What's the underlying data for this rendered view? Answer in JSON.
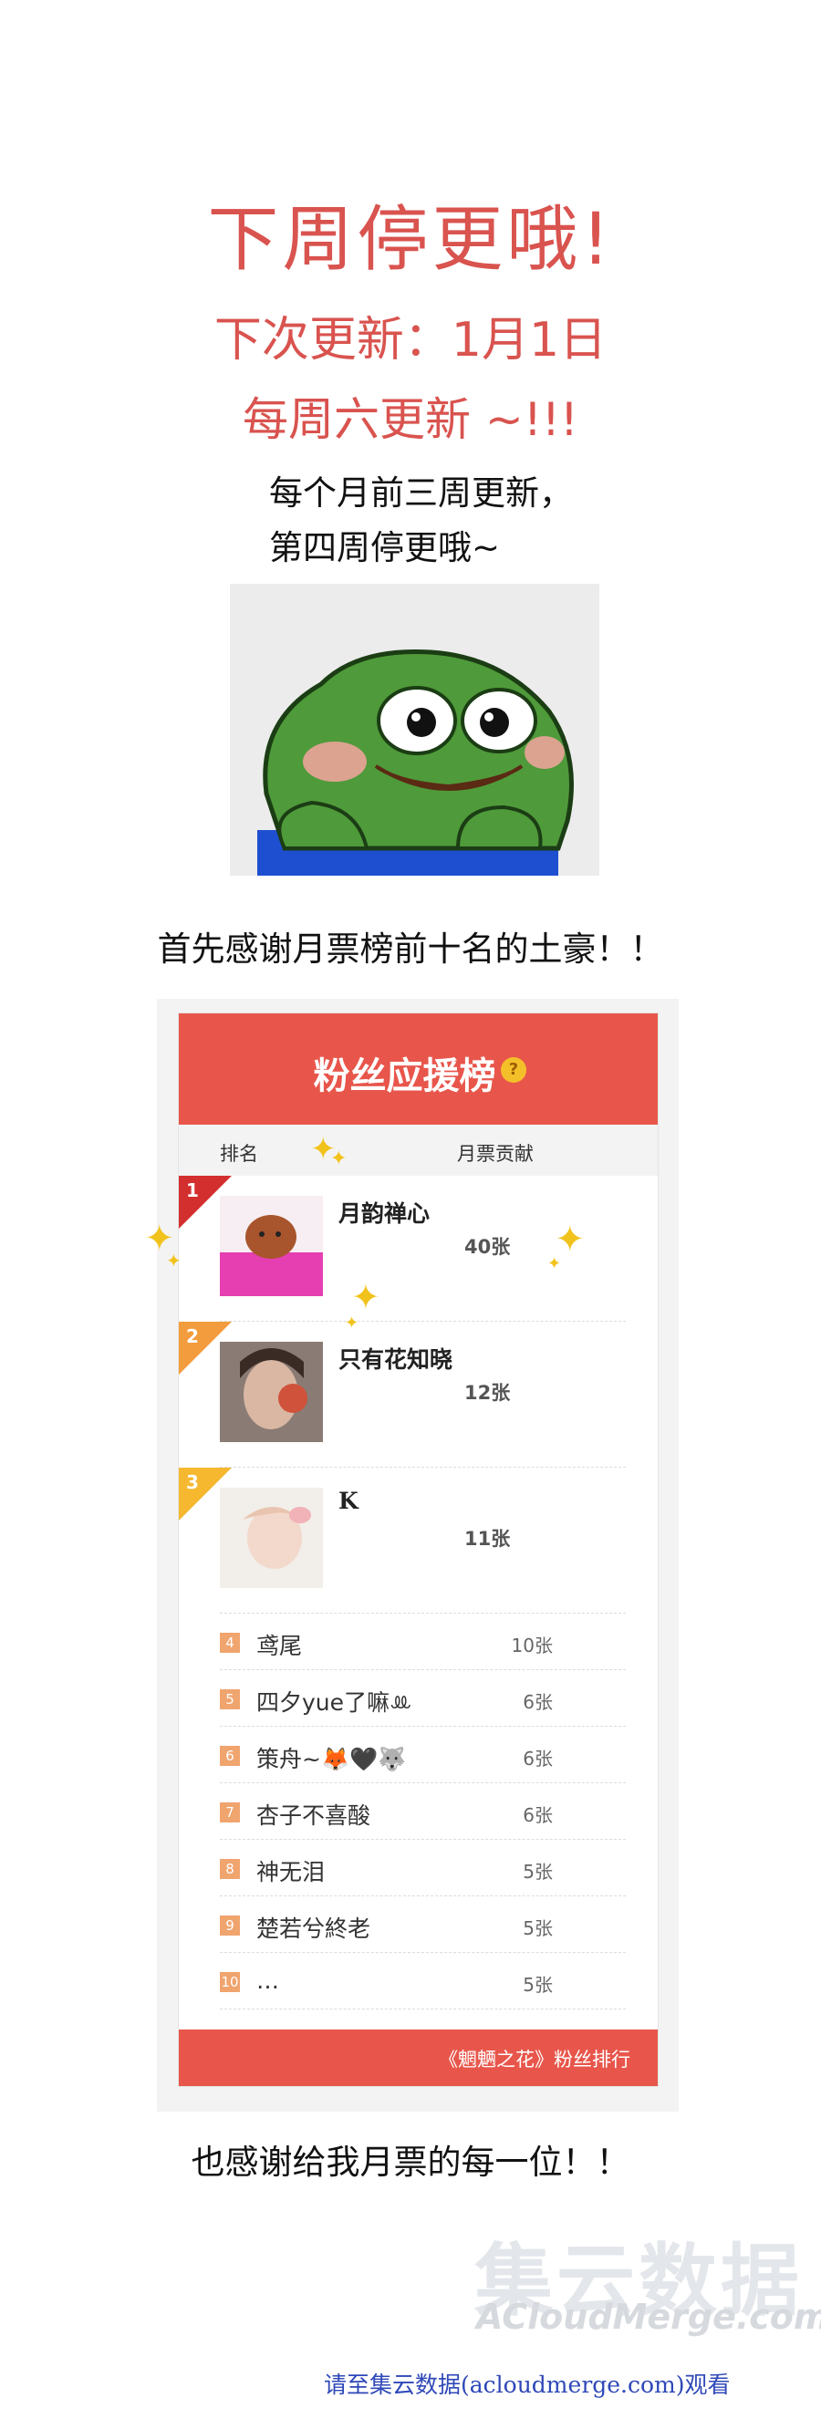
{
  "headings": {
    "main": "下周停更哦!",
    "next_update": "下次更新：1月1日",
    "weekly": "每周六更新 ~!!!",
    "note_line1": "每个月前三周更新，",
    "note_line2": "第四周停更哦~"
  },
  "thanks_top": "首先感谢月票榜前十名的土豪！！",
  "leaderboard": {
    "title": "粉丝应援榜",
    "help_icon": "?",
    "col_rank": "排名",
    "col_contribution": "月票贡献",
    "top": [
      {
        "rank": "1",
        "name": "月韵禅心",
        "value": "40张",
        "badge_color": "#d32f2f"
      },
      {
        "rank": "2",
        "name": "只有花知晓",
        "value": "12张",
        "badge_color": "#f39c3d"
      },
      {
        "rank": "3",
        "name": "K",
        "value": "11张",
        "badge_color": "#f5b82e"
      }
    ],
    "rows": [
      {
        "rank": "4",
        "name": "鸢尾",
        "value": "10张"
      },
      {
        "rank": "5",
        "name": "四夕yue了嘛ꔛ",
        "value": "6张"
      },
      {
        "rank": "6",
        "name": "策舟~🦊🖤🐺",
        "value": "6张"
      },
      {
        "rank": "7",
        "name": "杏子不喜酸",
        "value": "6张"
      },
      {
        "rank": "8",
        "name": "神无泪",
        "value": "5张"
      },
      {
        "rank": "9",
        "name": "楚若兮終老",
        "value": "5张"
      },
      {
        "rank": "10",
        "name": "…",
        "value": "5张"
      }
    ],
    "footer": "《魍魉之花》粉丝排行"
  },
  "thanks_bottom": "也感谢给我月票的每一位！！",
  "watermark": {
    "chinese": "集云数据",
    "english": "ACloudMerge.com"
  },
  "source_link": "请至集云数据(acloudmerge.com)观看"
}
